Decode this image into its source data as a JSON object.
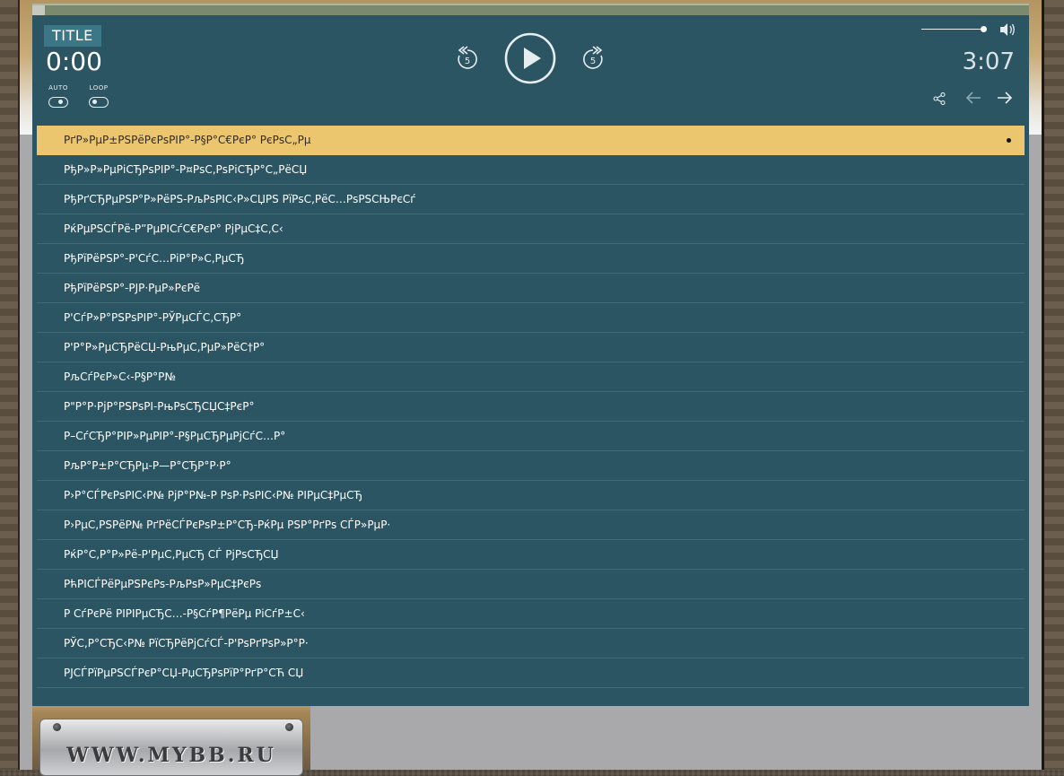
{
  "player": {
    "title_badge": "TITLE",
    "current_time": "0:00",
    "total_time": "3:07",
    "volume_level": 0.9,
    "auto_label": "AUTO",
    "loop_label": "LOOP",
    "auto_on": false,
    "loop_on": false,
    "icons": {
      "rewind": "rewind-5-icon",
      "play": "play-icon",
      "forward": "forward-5-icon",
      "volume": "speaker-icon",
      "share": "share-icon",
      "prev": "arrow-left-icon",
      "next": "arrow-right-icon"
    }
  },
  "playlist": {
    "active_index": 0,
    "tracks": [
      "РґР»РµР±РЅРёРєРѕРІР°-Р§Р°С€РєР° РєРѕС„Рµ",
      "РђР»Р»РµРіСЂРѕРІР°-Р¤РѕС‚РѕРіСЂР°С„РёСЏ",
      "РђРґСЂРµРЅР°Р»РёРЅ-РљРѕРІС‹Р»СЏРЅ РїРѕС‚РёС…РѕРЅСЊРєСѓ",
      "РќРµРЅСЃРё-Р”РµРІСѓС€РєР° РјРµС‡С‚С‹",
      "РђРїРёРЅР°-Р'СѓС…РіР°Р»С‚РµСЂ",
      "РђРїРёРЅР°-РЈР·РµР»РєРё",
      "Р'СѓР»Р°РЅРѕРІР°-РЎРµСЃС‚СЂР°",
      "Р'Р°Р»РµСЂРёСЏ-РњРµС‚РµР»РёС†Р°",
      "РљСѓРєР»С‹-Р§Р°Р№",
      "Р\"Р°Р·РјР°РЅРѕРІ-РњРѕСЂСЏС‡РєР°",
      "Р–СѓСЂР°РІР»РµРІР°-Р§РµСЂРµРјСѓС…Р°",
      "РљР°Р±Р°СЂРµ-Р—Р°СЂР°Р·Р°",
      "Р›Р°СЃРєРѕРІС‹Р№ РјР°Р№-Р РѕР·РѕРІС‹Р№ РІРµС‡РµСЂ",
      "Р›РµС‚РЅРёР№ РґРёСЃРєРѕР±Р°СЂ-РќРµ РЅР°РґРѕ СЃР»РµР·",
      "РќР°С‚Р°Р»Рё-Р'РµС‚РµСЂ СЃ РјРѕСЂСЏ",
      "РћРІСЃРёРµРЅРєРѕ-РљРѕР»РµС‡РєРѕ",
      "Р СѓРєРё РІРІРµСЂС…-Р§СѓР¶РёРµ РіСѓР±С‹",
      "РЎС‚Р°СЂС‹Р№ РїСЂРёРјСѓСЃ-Р'РѕРґРѕР»Р°Р·",
      "РЈСЃРїРµРЅСЃРєР°СЏ-РџСЂРѕРїР°РґР°СЋ СЏ"
    ]
  },
  "logo": {
    "text": "WWW.MYBB.RU"
  }
}
